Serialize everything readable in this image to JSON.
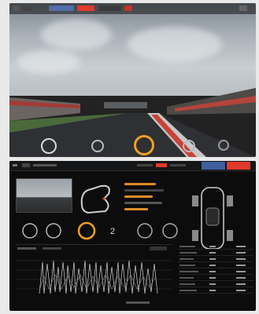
{
  "top_view": {
    "accent_color": "#e23a2a",
    "hud_bar": {
      "brand_pill_color": "#e23a2a",
      "tab_pill_color": "#4f6ea8"
    },
    "gauges": [
      "speed-gauge",
      "gear-gauge",
      "rpm-gauge",
      "brake-gauge",
      "throttle-gauge"
    ]
  },
  "telemetry_panel": {
    "accent_color": "#e23a2a",
    "tab_color": "#3f5fa0",
    "gauge_icons": [
      "speed-dial-icon",
      "brake-dial-icon",
      "rpm-dial-icon",
      "gear-indicator-icon",
      "steering-icon",
      "wheel-icon"
    ]
  }
}
